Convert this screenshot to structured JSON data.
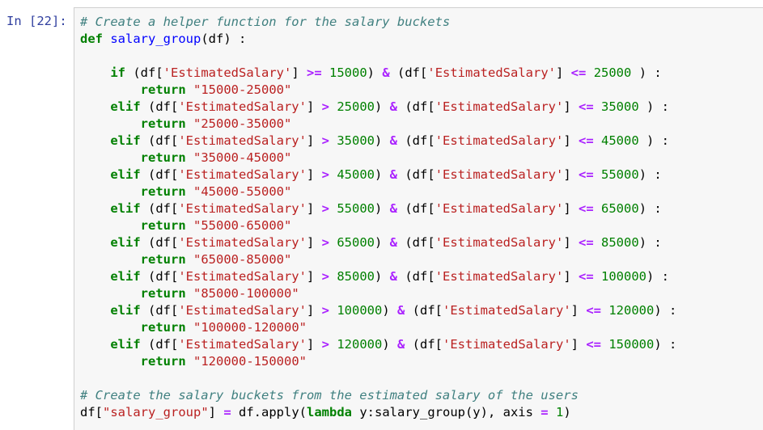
{
  "cell": {
    "prompt": "In [22]:"
  },
  "code_lines": [
    [
      [
        "cm",
        "# Create a helper function for the salary buckets"
      ]
    ],
    [
      [
        "kw",
        "def"
      ],
      [
        "tx",
        " "
      ],
      [
        "nf",
        "salary_group"
      ],
      [
        "tx",
        "(df) :"
      ]
    ],
    [
      [
        "tx",
        ""
      ]
    ],
    [
      [
        "tx",
        "    "
      ],
      [
        "kw",
        "if"
      ],
      [
        "tx",
        " (df["
      ],
      [
        "st",
        "'EstimatedSalary'"
      ],
      [
        "tx",
        "] "
      ],
      [
        "op",
        ">="
      ],
      [
        "tx",
        " "
      ],
      [
        "nm",
        "15000"
      ],
      [
        "tx",
        ") "
      ],
      [
        "op",
        "&"
      ],
      [
        "tx",
        " (df["
      ],
      [
        "st",
        "'EstimatedSalary'"
      ],
      [
        "tx",
        "] "
      ],
      [
        "op",
        "<="
      ],
      [
        "tx",
        " "
      ],
      [
        "nm",
        "25000"
      ],
      [
        "tx",
        " ) :"
      ]
    ],
    [
      [
        "tx",
        "        "
      ],
      [
        "kw",
        "return"
      ],
      [
        "tx",
        " "
      ],
      [
        "st",
        "\"15000-25000\""
      ]
    ],
    [
      [
        "tx",
        "    "
      ],
      [
        "kw",
        "elif"
      ],
      [
        "tx",
        " (df["
      ],
      [
        "st",
        "'EstimatedSalary'"
      ],
      [
        "tx",
        "] "
      ],
      [
        "op",
        ">"
      ],
      [
        "tx",
        " "
      ],
      [
        "nm",
        "25000"
      ],
      [
        "tx",
        ") "
      ],
      [
        "op",
        "&"
      ],
      [
        "tx",
        " (df["
      ],
      [
        "st",
        "'EstimatedSalary'"
      ],
      [
        "tx",
        "] "
      ],
      [
        "op",
        "<="
      ],
      [
        "tx",
        " "
      ],
      [
        "nm",
        "35000"
      ],
      [
        "tx",
        " ) :"
      ]
    ],
    [
      [
        "tx",
        "        "
      ],
      [
        "kw",
        "return"
      ],
      [
        "tx",
        " "
      ],
      [
        "st",
        "\"25000-35000\""
      ]
    ],
    [
      [
        "tx",
        "    "
      ],
      [
        "kw",
        "elif"
      ],
      [
        "tx",
        " (df["
      ],
      [
        "st",
        "'EstimatedSalary'"
      ],
      [
        "tx",
        "] "
      ],
      [
        "op",
        ">"
      ],
      [
        "tx",
        " "
      ],
      [
        "nm",
        "35000"
      ],
      [
        "tx",
        ") "
      ],
      [
        "op",
        "&"
      ],
      [
        "tx",
        " (df["
      ],
      [
        "st",
        "'EstimatedSalary'"
      ],
      [
        "tx",
        "] "
      ],
      [
        "op",
        "<="
      ],
      [
        "tx",
        " "
      ],
      [
        "nm",
        "45000"
      ],
      [
        "tx",
        " ) :"
      ]
    ],
    [
      [
        "tx",
        "        "
      ],
      [
        "kw",
        "return"
      ],
      [
        "tx",
        " "
      ],
      [
        "st",
        "\"35000-45000\""
      ]
    ],
    [
      [
        "tx",
        "    "
      ],
      [
        "kw",
        "elif"
      ],
      [
        "tx",
        " (df["
      ],
      [
        "st",
        "'EstimatedSalary'"
      ],
      [
        "tx",
        "] "
      ],
      [
        "op",
        ">"
      ],
      [
        "tx",
        " "
      ],
      [
        "nm",
        "45000"
      ],
      [
        "tx",
        ") "
      ],
      [
        "op",
        "&"
      ],
      [
        "tx",
        " (df["
      ],
      [
        "st",
        "'EstimatedSalary'"
      ],
      [
        "tx",
        "] "
      ],
      [
        "op",
        "<="
      ],
      [
        "tx",
        " "
      ],
      [
        "nm",
        "55000"
      ],
      [
        "tx",
        ") :"
      ]
    ],
    [
      [
        "tx",
        "        "
      ],
      [
        "kw",
        "return"
      ],
      [
        "tx",
        " "
      ],
      [
        "st",
        "\"45000-55000\""
      ]
    ],
    [
      [
        "tx",
        "    "
      ],
      [
        "kw",
        "elif"
      ],
      [
        "tx",
        " (df["
      ],
      [
        "st",
        "'EstimatedSalary'"
      ],
      [
        "tx",
        "] "
      ],
      [
        "op",
        ">"
      ],
      [
        "tx",
        " "
      ],
      [
        "nm",
        "55000"
      ],
      [
        "tx",
        ") "
      ],
      [
        "op",
        "&"
      ],
      [
        "tx",
        " (df["
      ],
      [
        "st",
        "'EstimatedSalary'"
      ],
      [
        "tx",
        "] "
      ],
      [
        "op",
        "<="
      ],
      [
        "tx",
        " "
      ],
      [
        "nm",
        "65000"
      ],
      [
        "tx",
        ") :"
      ]
    ],
    [
      [
        "tx",
        "        "
      ],
      [
        "kw",
        "return"
      ],
      [
        "tx",
        " "
      ],
      [
        "st",
        "\"55000-65000\""
      ]
    ],
    [
      [
        "tx",
        "    "
      ],
      [
        "kw",
        "elif"
      ],
      [
        "tx",
        " (df["
      ],
      [
        "st",
        "'EstimatedSalary'"
      ],
      [
        "tx",
        "] "
      ],
      [
        "op",
        ">"
      ],
      [
        "tx",
        " "
      ],
      [
        "nm",
        "65000"
      ],
      [
        "tx",
        ") "
      ],
      [
        "op",
        "&"
      ],
      [
        "tx",
        " (df["
      ],
      [
        "st",
        "'EstimatedSalary'"
      ],
      [
        "tx",
        "] "
      ],
      [
        "op",
        "<="
      ],
      [
        "tx",
        " "
      ],
      [
        "nm",
        "85000"
      ],
      [
        "tx",
        ") :"
      ]
    ],
    [
      [
        "tx",
        "        "
      ],
      [
        "kw",
        "return"
      ],
      [
        "tx",
        " "
      ],
      [
        "st",
        "\"65000-85000\""
      ]
    ],
    [
      [
        "tx",
        "    "
      ],
      [
        "kw",
        "elif"
      ],
      [
        "tx",
        " (df["
      ],
      [
        "st",
        "'EstimatedSalary'"
      ],
      [
        "tx",
        "] "
      ],
      [
        "op",
        ">"
      ],
      [
        "tx",
        " "
      ],
      [
        "nm",
        "85000"
      ],
      [
        "tx",
        ") "
      ],
      [
        "op",
        "&"
      ],
      [
        "tx",
        " (df["
      ],
      [
        "st",
        "'EstimatedSalary'"
      ],
      [
        "tx",
        "] "
      ],
      [
        "op",
        "<="
      ],
      [
        "tx",
        " "
      ],
      [
        "nm",
        "100000"
      ],
      [
        "tx",
        ") :"
      ]
    ],
    [
      [
        "tx",
        "        "
      ],
      [
        "kw",
        "return"
      ],
      [
        "tx",
        " "
      ],
      [
        "st",
        "\"85000-100000\""
      ]
    ],
    [
      [
        "tx",
        "    "
      ],
      [
        "kw",
        "elif"
      ],
      [
        "tx",
        " (df["
      ],
      [
        "st",
        "'EstimatedSalary'"
      ],
      [
        "tx",
        "] "
      ],
      [
        "op",
        ">"
      ],
      [
        "tx",
        " "
      ],
      [
        "nm",
        "100000"
      ],
      [
        "tx",
        ") "
      ],
      [
        "op",
        "&"
      ],
      [
        "tx",
        " (df["
      ],
      [
        "st",
        "'EstimatedSalary'"
      ],
      [
        "tx",
        "] "
      ],
      [
        "op",
        "<="
      ],
      [
        "tx",
        " "
      ],
      [
        "nm",
        "120000"
      ],
      [
        "tx",
        ") :"
      ]
    ],
    [
      [
        "tx",
        "        "
      ],
      [
        "kw",
        "return"
      ],
      [
        "tx",
        " "
      ],
      [
        "st",
        "\"100000-120000\""
      ]
    ],
    [
      [
        "tx",
        "    "
      ],
      [
        "kw",
        "elif"
      ],
      [
        "tx",
        " (df["
      ],
      [
        "st",
        "'EstimatedSalary'"
      ],
      [
        "tx",
        "] "
      ],
      [
        "op",
        ">"
      ],
      [
        "tx",
        " "
      ],
      [
        "nm",
        "120000"
      ],
      [
        "tx",
        ") "
      ],
      [
        "op",
        "&"
      ],
      [
        "tx",
        " (df["
      ],
      [
        "st",
        "'EstimatedSalary'"
      ],
      [
        "tx",
        "] "
      ],
      [
        "op",
        "<="
      ],
      [
        "tx",
        " "
      ],
      [
        "nm",
        "150000"
      ],
      [
        "tx",
        ") :"
      ]
    ],
    [
      [
        "tx",
        "        "
      ],
      [
        "kw",
        "return"
      ],
      [
        "tx",
        " "
      ],
      [
        "st",
        "\"120000-150000\""
      ]
    ],
    [
      [
        "tx",
        ""
      ]
    ],
    [
      [
        "cm",
        "# Create the salary buckets from the estimated salary of the users"
      ]
    ],
    [
      [
        "tx",
        "df["
      ],
      [
        "st",
        "\"salary_group\""
      ],
      [
        "tx",
        "] "
      ],
      [
        "op",
        "="
      ],
      [
        "tx",
        " df.apply("
      ],
      [
        "kw",
        "lambda"
      ],
      [
        "tx",
        " y:salary_group(y), axis "
      ],
      [
        "op",
        "="
      ],
      [
        "tx",
        " "
      ],
      [
        "nm",
        "1"
      ],
      [
        "tx",
        ")"
      ]
    ]
  ],
  "colors": {
    "prompt": "#303f9f",
    "comment": "#408080",
    "keyword": "#008000",
    "function": "#0000ff",
    "string": "#ba2121",
    "number": "#008000",
    "operator": "#aa22ff",
    "cell_background": "#f7f7f7",
    "cell_border": "#cfcfcf"
  }
}
